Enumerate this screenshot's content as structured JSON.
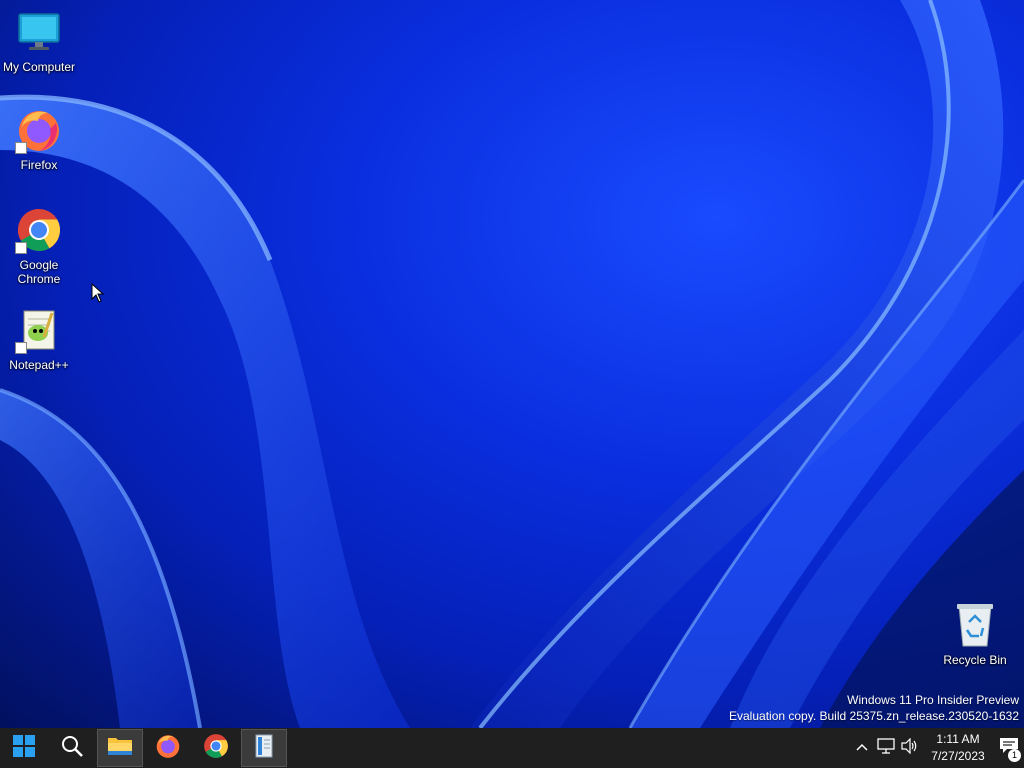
{
  "desktop": {
    "icons": [
      {
        "label": "My Computer",
        "icon": "monitor-icon",
        "shortcut": false
      },
      {
        "label": "Firefox",
        "icon": "firefox-icon",
        "shortcut": true
      },
      {
        "label": "Google Chrome",
        "icon": "chrome-icon",
        "shortcut": true
      },
      {
        "label": "Notepad++",
        "icon": "notepadpp-icon",
        "shortcut": true
      },
      {
        "label": "Recycle Bin",
        "icon": "recycle-bin-icon",
        "shortcut": false
      }
    ],
    "watermark": {
      "line1": "Windows 11 Pro Insider Preview",
      "line2": "Evaluation copy. Build 25375.zn_release.230520-1632"
    }
  },
  "taskbar": {
    "items": [
      {
        "icon": "windows-start-icon",
        "state": "normal"
      },
      {
        "icon": "search-icon",
        "state": "normal"
      },
      {
        "icon": "file-explorer-icon",
        "state": "running"
      },
      {
        "icon": "firefox-icon",
        "state": "normal"
      },
      {
        "icon": "chrome-icon",
        "state": "normal"
      },
      {
        "icon": "app-window-icon",
        "state": "active"
      }
    ],
    "tray": {
      "time": "1:11 AM",
      "date": "7/27/2023",
      "notification_count": "1"
    }
  },
  "colors": {
    "taskbar_bg": "#1f1f1f",
    "wallpaper_accent": "#0a2fe0"
  }
}
